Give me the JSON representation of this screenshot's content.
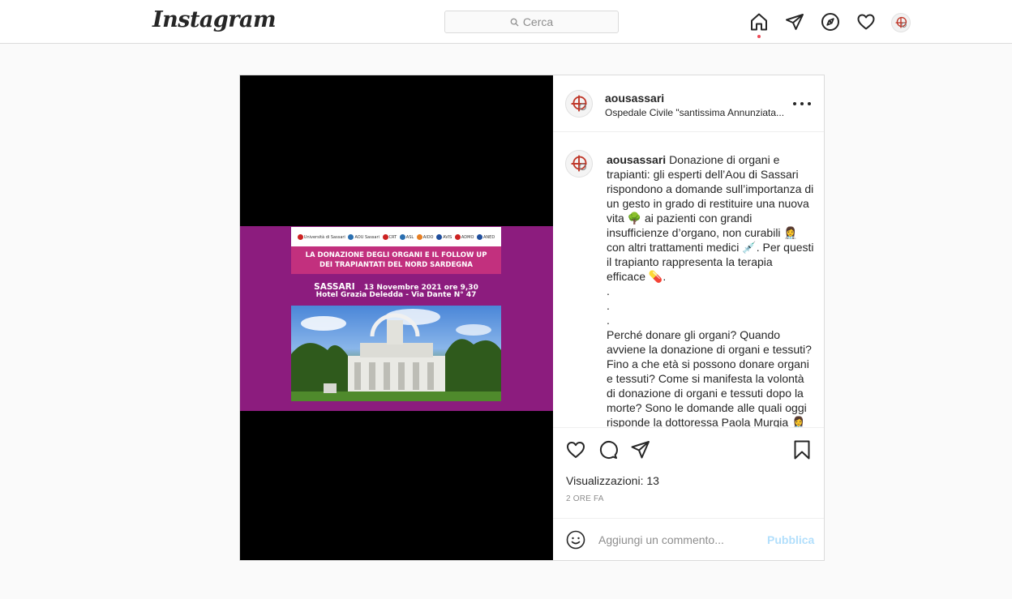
{
  "app": {
    "logo": "Instagram"
  },
  "search": {
    "placeholder": "Cerca"
  },
  "nav": {
    "icons": [
      "home-icon",
      "direct-icon",
      "explore-icon",
      "activity-heart-icon",
      "profile-avatar"
    ],
    "active": "home",
    "notification_dot_color": "#ed4956"
  },
  "post": {
    "username": "aousassari",
    "location": "Ospedale Civile \"santissima Annunziata...",
    "poster": {
      "logos": [
        "Università di Sassari",
        "AOU Sassari",
        "CRT",
        "ASL",
        "AIDO",
        "AVIS",
        "ADMO",
        "ANED"
      ],
      "title_line1": "LA DONAZIONE DEGLI ORGANI E IL FOLLOW UP",
      "title_line2": "DEI TRAPIANTATI DEL NORD SARDEGNA",
      "city": "SASSARI",
      "date": "13 Novembre 2021  ore 9,30",
      "venue": "Hotel Grazia Deledda - Via  Dante  N° 47"
    },
    "caption_user": "aousassari",
    "caption_text": "Donazione di organi e trapianti: gli esperti dell’Aou di Sassari rispondono a domande sull’importanza di un gesto in grado di restituire una nuova vita 🌳 ai pazienti con grandi insufficienze d’organo, non curabili 👩‍⚕️ con altri trattamenti medici 💉. Per questi il trapianto rappresenta la terapia efficace 💊.\n.\n.\n.\nPerché donare gli organi? Quando avviene la donazione di organi e tessuti? Fino a che età si possono donare organi e tessuti? Come si manifesta la volontà di donazione di organi e tessuti dopo la morte? Sono le domande alle quali oggi risponde la dottoressa Paola Murgia 👩‍⚕️",
    "views_label": "Visualizzazioni:",
    "views_count": "13",
    "timestamp": "2 ORE FA",
    "comment_placeholder": "Aggiungi un commento...",
    "publish_label": "Pubblica",
    "publish_color": "#b2dffc"
  }
}
